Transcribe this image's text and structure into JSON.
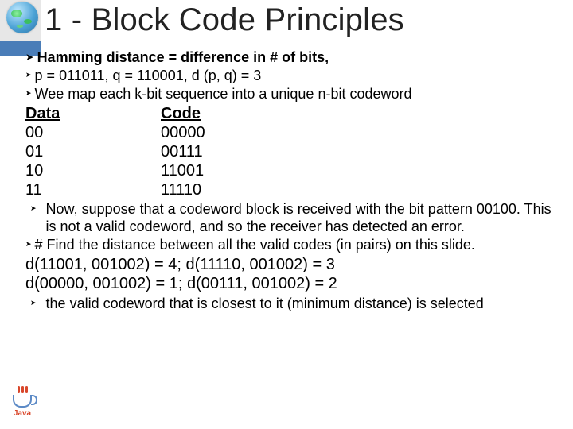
{
  "title": "1 - Block Code Principles",
  "bullets": {
    "hamming": {
      "lead": "Hamming",
      "rest": "distance = difference in # of bits,"
    },
    "pq": "p = 011011, q = 110001, d (p, q) = 3",
    "map": "Wee map each k-bit sequence into a unique n-bit codeword",
    "now": "Now, suppose that a codeword block is received with the bit pattern 00100. This is not a valid codeword, and so the receiver has detected an error.",
    "find": "# Find the distance between all the valid codes (in pairs) on this slide.",
    "select": "the valid codeword that is closest to it (minimum distance) is selected"
  },
  "table": {
    "headers": [
      "Data",
      "Code"
    ],
    "rows": [
      [
        "00",
        "00000"
      ],
      [
        "01",
        "00111"
      ],
      [
        "10",
        "11001"
      ],
      [
        "11",
        "11110"
      ]
    ]
  },
  "distances": [
    "d(11001, 001002) = 4; d(11110, 001002) = 3",
    "d(00000, 001002) = 1; d(00111, 001002) = 2"
  ],
  "footer": {
    "java": "Java"
  }
}
